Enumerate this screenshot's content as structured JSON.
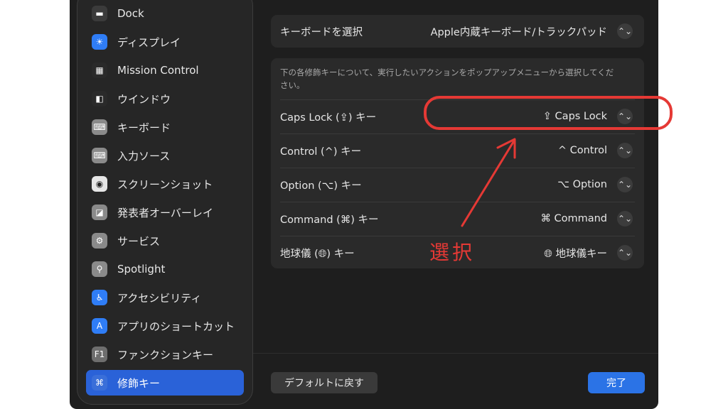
{
  "sidebar": {
    "items": [
      {
        "label": "Dock",
        "icon": "dock-icon",
        "color": "#3b3b3b",
        "glyph": "▬"
      },
      {
        "label": "ディスプレイ",
        "icon": "display-brightness-icon",
        "color": "#2f7df6",
        "glyph": "☀"
      },
      {
        "label": "Mission Control",
        "icon": "mission-control-icon",
        "color": "#2a2a2a",
        "glyph": "▦"
      },
      {
        "label": "ウインドウ",
        "icon": "window-icon",
        "color": "#2a2a2a",
        "glyph": "◧"
      },
      {
        "label": "キーボード",
        "icon": "keyboard-icon",
        "color": "#8a8a8a",
        "glyph": "⌨"
      },
      {
        "label": "入力ソース",
        "icon": "input-source-icon",
        "color": "#8a8a8a",
        "glyph": "⌨"
      },
      {
        "label": "スクリーンショット",
        "icon": "screenshot-camera-icon",
        "color": "#e6e6e6",
        "glyph": "◉"
      },
      {
        "label": "発表者オーバーレイ",
        "icon": "presenter-overlay-icon",
        "color": "#8a8a8a",
        "glyph": "◪"
      },
      {
        "label": "サービス",
        "icon": "services-gear-icon",
        "color": "#8a8a8a",
        "glyph": "⚙"
      },
      {
        "label": "Spotlight",
        "icon": "spotlight-search-icon",
        "color": "#8a8a8a",
        "glyph": "⚲"
      },
      {
        "label": "アクセシビリティ",
        "icon": "accessibility-icon",
        "color": "#2f7df6",
        "glyph": "♿"
      },
      {
        "label": "アプリのショートカット",
        "icon": "app-shortcuts-icon",
        "color": "#2f7df6",
        "glyph": "A"
      },
      {
        "label": "ファンクションキー",
        "icon": "function-key-icon",
        "color": "#6e6e6e",
        "glyph": "F1"
      },
      {
        "label": "修飾キー",
        "icon": "modifier-key-icon",
        "color": "#3a6fd9",
        "glyph": "⌘",
        "selected": true
      }
    ]
  },
  "keyboard_select": {
    "label": "キーボードを選択",
    "value": "Apple内蔵キーボード/トラックパッド"
  },
  "modifiers": {
    "description": "下の各修飾キーについて、実行したいアクションをポップアップメニューから選択してください。",
    "rows": [
      {
        "label": "Caps Lock (⇪) キー",
        "value": "⇪ Caps Lock"
      },
      {
        "label": "Control (^) キー",
        "value": "^ Control"
      },
      {
        "label": "Option (⌥) キー",
        "value": "⌥ Option"
      },
      {
        "label": "Command (⌘) キー",
        "value": "⌘ Command"
      },
      {
        "label": "地球儀 (🌐︎) キー",
        "value": "🌐︎ 地球儀キー"
      }
    ]
  },
  "footer": {
    "default_label": "デフォルトに戻す",
    "done_label": "完了"
  },
  "annotation": {
    "label": "選択",
    "color": "#e53935"
  }
}
